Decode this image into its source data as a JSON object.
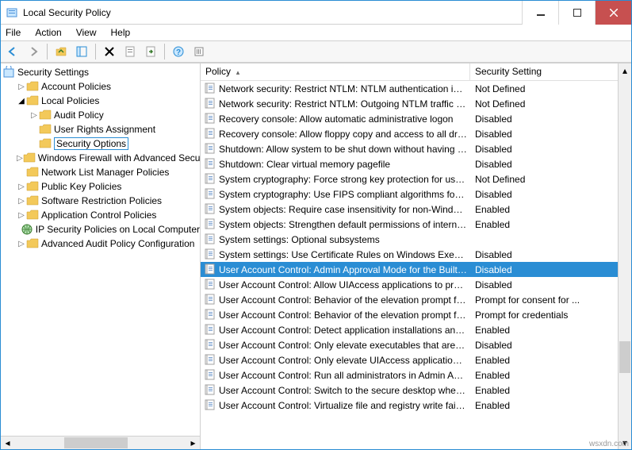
{
  "window": {
    "title": "Local Security Policy"
  },
  "menu": {
    "file": "File",
    "action": "Action",
    "view": "View",
    "help": "Help"
  },
  "tree": {
    "root": "Security Settings",
    "items": [
      {
        "label": "Account Policies",
        "depth": 1,
        "expandable": true,
        "expanded": false
      },
      {
        "label": "Local Policies",
        "depth": 1,
        "expandable": true,
        "expanded": true
      },
      {
        "label": "Audit Policy",
        "depth": 2,
        "expandable": true,
        "expanded": false
      },
      {
        "label": "User Rights Assignment",
        "depth": 2,
        "expandable": false,
        "expanded": false
      },
      {
        "label": "Security Options",
        "depth": 2,
        "expandable": false,
        "expanded": false,
        "selected": true
      },
      {
        "label": "Windows Firewall with Advanced Security",
        "depth": 1,
        "expandable": true,
        "expanded": false
      },
      {
        "label": "Network List Manager Policies",
        "depth": 1,
        "expandable": false,
        "expanded": false
      },
      {
        "label": "Public Key Policies",
        "depth": 1,
        "expandable": true,
        "expanded": false
      },
      {
        "label": "Software Restriction Policies",
        "depth": 1,
        "expandable": true,
        "expanded": false
      },
      {
        "label": "Application Control Policies",
        "depth": 1,
        "expandable": true,
        "expanded": false
      },
      {
        "label": "IP Security Policies on Local Computer",
        "depth": 1,
        "expandable": false,
        "expanded": false,
        "icon": "ip"
      },
      {
        "label": "Advanced Audit Policy Configuration",
        "depth": 1,
        "expandable": true,
        "expanded": false
      }
    ]
  },
  "list": {
    "col_policy": "Policy",
    "col_setting": "Security Setting",
    "rows": [
      {
        "policy": "Network security: Restrict NTLM: NTLM authentication in th...",
        "setting": "Not Defined"
      },
      {
        "policy": "Network security: Restrict NTLM: Outgoing NTLM traffic to ...",
        "setting": "Not Defined"
      },
      {
        "policy": "Recovery console: Allow automatic administrative logon",
        "setting": "Disabled"
      },
      {
        "policy": "Recovery console: Allow floppy copy and access to all drives...",
        "setting": "Disabled"
      },
      {
        "policy": "Shutdown: Allow system to be shut down without having to...",
        "setting": "Disabled"
      },
      {
        "policy": "Shutdown: Clear virtual memory pagefile",
        "setting": "Disabled"
      },
      {
        "policy": "System cryptography: Force strong key protection for user k...",
        "setting": "Not Defined"
      },
      {
        "policy": "System cryptography: Use FIPS compliant algorithms for en...",
        "setting": "Disabled"
      },
      {
        "policy": "System objects: Require case insensitivity for non-Windows ...",
        "setting": "Enabled"
      },
      {
        "policy": "System objects: Strengthen default permissions of internal s...",
        "setting": "Enabled"
      },
      {
        "policy": "System settings: Optional subsystems",
        "setting": ""
      },
      {
        "policy": "System settings: Use Certificate Rules on Windows Executabl...",
        "setting": "Disabled"
      },
      {
        "policy": "User Account Control: Admin Approval Mode for the Built-i...",
        "setting": "Disabled",
        "selected": true
      },
      {
        "policy": "User Account Control: Allow UIAccess applications to prom...",
        "setting": "Disabled"
      },
      {
        "policy": "User Account Control: Behavior of the elevation prompt for ...",
        "setting": "Prompt for consent for ..."
      },
      {
        "policy": "User Account Control: Behavior of the elevation prompt for ...",
        "setting": "Prompt for credentials"
      },
      {
        "policy": "User Account Control: Detect application installations and p...",
        "setting": "Enabled"
      },
      {
        "policy": "User Account Control: Only elevate executables that are sign...",
        "setting": "Disabled"
      },
      {
        "policy": "User Account Control: Only elevate UIAccess applications th...",
        "setting": "Enabled"
      },
      {
        "policy": "User Account Control: Run all administrators in Admin Appr...",
        "setting": "Enabled"
      },
      {
        "policy": "User Account Control: Switch to the secure desktop when pr...",
        "setting": "Enabled"
      },
      {
        "policy": "User Account Control: Virtualize file and registry write failure...",
        "setting": "Enabled"
      }
    ]
  },
  "watermark": "wsxdn.com"
}
